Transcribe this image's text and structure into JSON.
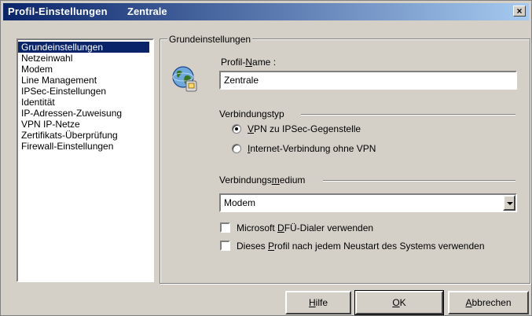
{
  "window": {
    "title": "Profil-Einstellungen",
    "profile_title": "Zentrale",
    "close_glyph": "×"
  },
  "sidebar": {
    "items": [
      {
        "label": "Grundeinstellungen",
        "selected": true
      },
      {
        "label": "Netzeinwahl"
      },
      {
        "label": "Modem"
      },
      {
        "label": "Line Management"
      },
      {
        "label": "IPSec-Einstellungen"
      },
      {
        "label": "Identität"
      },
      {
        "label": "IP-Adressen-Zuweisung"
      },
      {
        "label": "VPN IP-Netze"
      },
      {
        "label": "Zertifikats-Überprüfung"
      },
      {
        "label": "Firewall-Einstellungen"
      }
    ]
  },
  "main": {
    "group_title": "Grundeinstellungen",
    "profile_name_label_pre": "Profil-",
    "profile_name_label_u": "N",
    "profile_name_label_post": "ame :",
    "profile_name_value": "Zentrale",
    "connection_type_label": "Verbindungstyp",
    "radio_vpn_u": "V",
    "radio_vpn_rest": "PN zu IPSec-Gegenstelle",
    "radio_internet_u": "I",
    "radio_internet_rest": "nternet-Verbindung ohne VPN",
    "medium_label_pre": "Verbindungs",
    "medium_label_u": "m",
    "medium_label_post": "edium",
    "medium_value": "Modem",
    "check_dfue_pre": "Microsoft ",
    "check_dfue_u": "D",
    "check_dfue_post": "FÜ-Dialer verwenden",
    "check_restart_pre": "Dieses ",
    "check_restart_u": "P",
    "check_restart_post": "rofil nach jedem Neustart des Systems verwenden"
  },
  "buttons": {
    "help_u": "H",
    "help_rest": "ilfe",
    "ok_u": "O",
    "ok_rest": "K",
    "cancel_u": "A",
    "cancel_rest": "bbrechen"
  },
  "icons": {
    "profile": "globe-network-icon"
  },
  "colors": {
    "titlebar_start": "#0a246a",
    "titlebar_end": "#a6caf0",
    "selection": "#0a246a",
    "face": "#d4d0c8"
  }
}
